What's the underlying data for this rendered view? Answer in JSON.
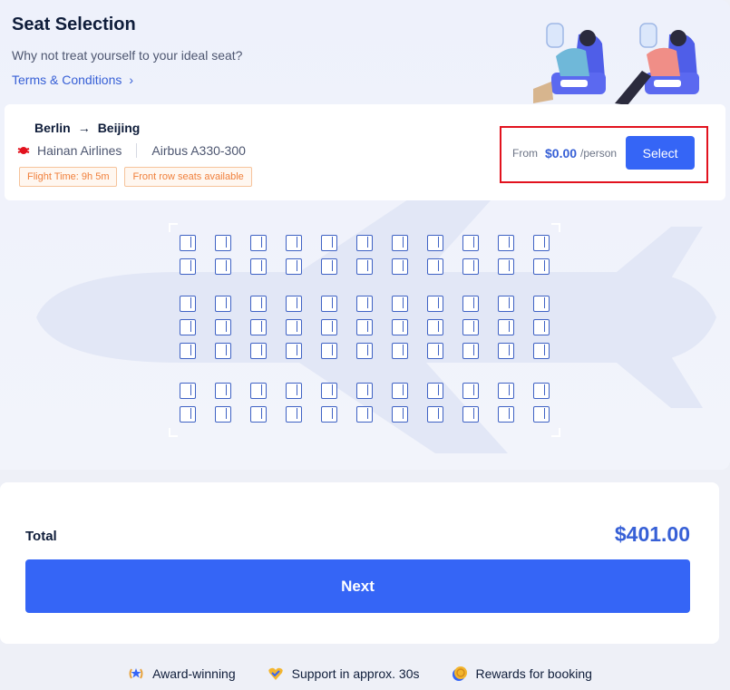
{
  "header": {
    "title": "Seat Selection",
    "subtitle": "Why not treat yourself to your ideal seat?",
    "terms_link": "Terms & Conditions",
    "terms_chevron": "›"
  },
  "flight": {
    "origin": "Berlin",
    "arrow": "→",
    "destination": "Beijing",
    "airline": "Hainan Airlines",
    "aircraft": "Airbus A330-300",
    "tags": [
      "Flight Time: 9h 5m",
      "Front row seats available"
    ]
  },
  "price": {
    "from_label": "From",
    "amount": "$0.00",
    "unit": "/person",
    "select_label": "Select"
  },
  "seat_map": {
    "columns": 11,
    "rows_per_block": [
      2,
      3,
      2
    ]
  },
  "summary": {
    "total_label": "Total",
    "total_amount": "$401.00",
    "next_label": "Next"
  },
  "benefits": [
    {
      "label": "Award-winning",
      "icon": "laurel-icon"
    },
    {
      "label": "Support in approx. 30s",
      "icon": "heart-check-icon"
    },
    {
      "label": "Rewards for booking",
      "icon": "coin-icon"
    }
  ],
  "colors": {
    "accent": "#3565f6",
    "price_text": "#3760d6",
    "tag_orange": "#f0803c",
    "highlight_red": "#e2121e"
  }
}
